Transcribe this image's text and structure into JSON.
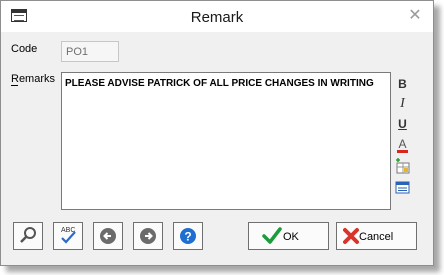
{
  "window": {
    "title": "Remark"
  },
  "code": {
    "label": "Code",
    "value": "PO1"
  },
  "remarks": {
    "label": "Remarks",
    "text": "PLEASE ADVISE PATRICK OF ALL PRICE CHANGES IN WRITING"
  },
  "format_toolbar": [
    {
      "name": "bold",
      "glyph": "B"
    },
    {
      "name": "italic",
      "glyph": "I"
    },
    {
      "name": "underline",
      "glyph": "U"
    },
    {
      "name": "font-color",
      "glyph": "A"
    }
  ],
  "buttons": {
    "ok_label": "OK",
    "cancel_label": "Cancel"
  },
  "colors": {
    "ok_check": "#1e9b3c",
    "cancel_x": "#d9342b",
    "help_blue": "#1f6fd1",
    "nav_gray": "#6b6b6b"
  }
}
